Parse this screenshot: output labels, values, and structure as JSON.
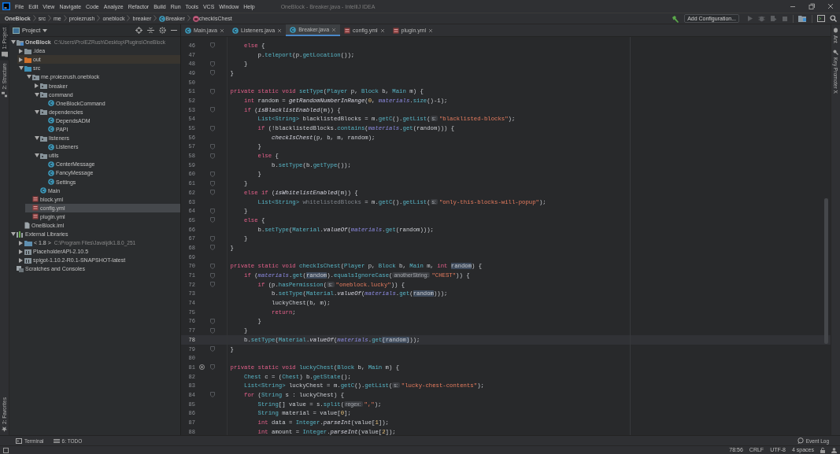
{
  "window": {
    "title": "OneBlock - Breaker.java - IntelliJ IDEA"
  },
  "menu": [
    "File",
    "Edit",
    "View",
    "Navigate",
    "Code",
    "Analyze",
    "Refactor",
    "Build",
    "Run",
    "Tools",
    "VCS",
    "Window",
    "Help"
  ],
  "breadcrumbs": [
    {
      "label": "OneBlock",
      "kind": "project"
    },
    {
      "label": "src",
      "kind": "plain"
    },
    {
      "label": "me",
      "kind": "plain"
    },
    {
      "label": "proiezrush",
      "kind": "plain"
    },
    {
      "label": "oneblock",
      "kind": "plain"
    },
    {
      "label": "breaker",
      "kind": "plain"
    },
    {
      "label": "Breaker",
      "kind": "class"
    },
    {
      "label": "checkIsChest",
      "kind": "method"
    }
  ],
  "toolbar": {
    "run_configuration": "Add Configuration..."
  },
  "left_tool_windows": [
    {
      "label": "1: Project",
      "selected": true
    },
    {
      "label": "2: Structure",
      "selected": false
    }
  ],
  "left_bottom_tool_windows": [
    {
      "label": "2: Favorites"
    }
  ],
  "right_tool_windows": [
    {
      "label": "Ant"
    },
    {
      "label": "Key Promoter X"
    }
  ],
  "project_panel": {
    "title": "Project",
    "tree": [
      {
        "label": "OneBlock",
        "detail": "C:\\Users\\ProIEZRush\\Desktop\\Plugins\\OneBlock",
        "kind": "module",
        "expanded": true,
        "selected": false,
        "hovered": false,
        "children": [
          {
            "label": ".idea",
            "kind": "folder",
            "expanded": false,
            "selected": false,
            "hovered": false
          },
          {
            "label": "out",
            "kind": "excluded",
            "expanded": false,
            "selected": false,
            "hovered": true
          },
          {
            "label": "src",
            "kind": "source",
            "expanded": true,
            "selected": false,
            "hovered": false,
            "children": [
              {
                "label": "me.proiezrush.oneblock",
                "kind": "package",
                "expanded": true,
                "selected": false,
                "hovered": false,
                "children": [
                  {
                    "label": "breaker",
                    "kind": "package",
                    "expanded": false,
                    "selected": false,
                    "hovered": false
                  },
                  {
                    "label": "command",
                    "kind": "package",
                    "expanded": true,
                    "selected": false,
                    "hovered": false,
                    "children": [
                      {
                        "label": "OneBlockCommand",
                        "kind": "class",
                        "selected": false,
                        "hovered": false
                      }
                    ]
                  },
                  {
                    "label": "dependencies",
                    "kind": "package",
                    "expanded": true,
                    "selected": false,
                    "hovered": false,
                    "children": [
                      {
                        "label": "DependsADM",
                        "kind": "class",
                        "selected": false,
                        "hovered": false
                      },
                      {
                        "label": "PAPI",
                        "kind": "class",
                        "selected": false,
                        "hovered": false
                      }
                    ]
                  },
                  {
                    "label": "listeners",
                    "kind": "package",
                    "expanded": true,
                    "selected": false,
                    "hovered": false,
                    "children": [
                      {
                        "label": "Listeners",
                        "kind": "class",
                        "selected": false,
                        "hovered": false
                      }
                    ]
                  },
                  {
                    "label": "utils",
                    "kind": "package",
                    "expanded": true,
                    "selected": false,
                    "hovered": false,
                    "children": [
                      {
                        "label": "CenterMessage",
                        "kind": "class",
                        "selected": false,
                        "hovered": false
                      },
                      {
                        "label": "FancyMessage",
                        "kind": "class",
                        "selected": false,
                        "hovered": false
                      },
                      {
                        "label": "Settings",
                        "kind": "class",
                        "selected": false,
                        "hovered": false
                      }
                    ]
                  },
                  {
                    "label": "Main",
                    "kind": "class",
                    "selected": false,
                    "hovered": false
                  }
                ]
              },
              {
                "label": "block.yml",
                "kind": "yml",
                "selected": false,
                "hovered": false
              },
              {
                "label": "config.yml",
                "kind": "yml",
                "selected": true,
                "hovered": false
              },
              {
                "label": "plugin.yml",
                "kind": "yml",
                "selected": false,
                "hovered": false
              }
            ]
          },
          {
            "label": "OneBlock.iml",
            "kind": "iml",
            "selected": false,
            "hovered": false
          }
        ]
      },
      {
        "label": "External Libraries",
        "kind": "libraries",
        "expanded": true,
        "selected": false,
        "hovered": false,
        "children": [
          {
            "label": "< 1.8 >",
            "detail": "C:\\Program Files\\Java\\jdk1.8.0_251",
            "kind": "jdk",
            "expanded": false,
            "selected": false,
            "hovered": false
          },
          {
            "label": "PlaceholderAPI-2.10.5",
            "kind": "library",
            "expanded": false,
            "selected": false,
            "hovered": false
          },
          {
            "label": "spigot-1.10.2-R0.1-SNAPSHOT-latest",
            "kind": "library",
            "expanded": false,
            "selected": false,
            "hovered": false
          }
        ]
      },
      {
        "label": "Scratches and Consoles",
        "kind": "scratches",
        "selected": false,
        "hovered": false
      }
    ]
  },
  "editor_tabs": [
    {
      "label": "Main.java",
      "kind": "class",
      "selected": false
    },
    {
      "label": "Listeners.java",
      "kind": "class",
      "selected": false
    },
    {
      "label": "Breaker.java",
      "kind": "class",
      "selected": true
    },
    {
      "label": "config.yml",
      "kind": "yml",
      "selected": false
    },
    {
      "label": "plugin.yml",
      "kind": "yml",
      "selected": false
    }
  ],
  "editor": {
    "lines": [
      {
        "number": "46",
        "fold": true,
        "current": false,
        "tokens": [
          {
            "kind": "keyword",
            "text": "        else"
          },
          {
            "kind": "plain",
            "text": " {"
          }
        ]
      },
      {
        "number": "47",
        "fold": false,
        "current": false,
        "tokens": [
          {
            "kind": "plain",
            "text": "            p."
          },
          {
            "kind": "method",
            "text": "teleport"
          },
          {
            "kind": "plain",
            "text": "(p."
          },
          {
            "kind": "method",
            "text": "getLocation"
          },
          {
            "kind": "plain",
            "text": "());"
          }
        ]
      },
      {
        "number": "48",
        "fold": true,
        "current": false,
        "tokens": [
          {
            "kind": "plain",
            "text": "        }"
          }
        ]
      },
      {
        "number": "49",
        "fold": true,
        "current": false,
        "tokens": [
          {
            "kind": "plain",
            "text": "    }"
          }
        ]
      },
      {
        "number": "50",
        "fold": false,
        "current": false
      },
      {
        "number": "51",
        "fold": true,
        "current": false,
        "tokens": [
          {
            "kind": "keyword",
            "text": "    private static void "
          },
          {
            "kind": "method",
            "text": "setType"
          },
          {
            "kind": "plain",
            "text": "("
          },
          {
            "kind": "type",
            "text": "Player"
          },
          {
            "kind": "plain",
            "text": " p, "
          },
          {
            "kind": "type",
            "text": "Block"
          },
          {
            "kind": "plain",
            "text": " b, "
          },
          {
            "kind": "type",
            "text": "Main"
          },
          {
            "kind": "plain",
            "text": " m) {"
          }
        ]
      },
      {
        "number": "52",
        "fold": false,
        "current": false,
        "tokens": [
          {
            "kind": "keyword",
            "text": "        int"
          },
          {
            "kind": "plain",
            "text": " random = "
          },
          {
            "kind": "static",
            "text": "getRandomNumberInRange"
          },
          {
            "kind": "plain",
            "text": "("
          },
          {
            "kind": "number",
            "text": "0"
          },
          {
            "kind": "plain",
            "text": ", "
          },
          {
            "kind": "field",
            "text": "materials"
          },
          {
            "kind": "plain",
            "text": "."
          },
          {
            "kind": "method",
            "text": "size"
          },
          {
            "kind": "plain",
            "text": "()-1);"
          }
        ]
      },
      {
        "number": "53",
        "fold": true,
        "current": false,
        "tokens": [
          {
            "kind": "keyword",
            "text": "        if"
          },
          {
            "kind": "plain",
            "text": " ("
          },
          {
            "kind": "static",
            "text": "isBlacklistEnabled"
          },
          {
            "kind": "plain",
            "text": "(m)) {"
          }
        ]
      },
      {
        "number": "54",
        "fold": false,
        "current": false,
        "tokens": [
          {
            "kind": "type",
            "text": "            List<String>"
          },
          {
            "kind": "plain",
            "text": " blacklistedBlocks = m."
          },
          {
            "kind": "method",
            "text": "getC"
          },
          {
            "kind": "plain",
            "text": "()."
          },
          {
            "kind": "method",
            "text": "getList"
          },
          {
            "kind": "plain",
            "text": "("
          },
          {
            "kind": "hint",
            "text": "s:"
          },
          {
            "kind": "string",
            "text": "\"blacklisted-blocks\""
          },
          {
            "kind": "plain",
            "text": ");"
          }
        ]
      },
      {
        "number": "55",
        "fold": true,
        "current": false,
        "tokens": [
          {
            "kind": "keyword",
            "text": "            if"
          },
          {
            "kind": "plain",
            "text": " (!blacklistedBlocks."
          },
          {
            "kind": "method",
            "text": "contains"
          },
          {
            "kind": "plain",
            "text": "("
          },
          {
            "kind": "field",
            "text": "materials"
          },
          {
            "kind": "plain",
            "text": "."
          },
          {
            "kind": "method",
            "text": "get"
          },
          {
            "kind": "plain",
            "text": "(random))) {"
          }
        ]
      },
      {
        "number": "56",
        "fold": false,
        "current": false,
        "tokens": [
          {
            "kind": "static",
            "text": "                checkIsChest"
          },
          {
            "kind": "plain",
            "text": "(p, b, m, random);"
          }
        ]
      },
      {
        "number": "57",
        "fold": true,
        "current": false,
        "tokens": [
          {
            "kind": "plain",
            "text": "            }"
          }
        ]
      },
      {
        "number": "58",
        "fold": true,
        "current": false,
        "tokens": [
          {
            "kind": "keyword",
            "text": "            else"
          },
          {
            "kind": "plain",
            "text": " {"
          }
        ]
      },
      {
        "number": "59",
        "fold": false,
        "current": false,
        "tokens": [
          {
            "kind": "plain",
            "text": "                b."
          },
          {
            "kind": "method",
            "text": "setType"
          },
          {
            "kind": "plain",
            "text": "(b."
          },
          {
            "kind": "method",
            "text": "getType"
          },
          {
            "kind": "plain",
            "text": "());"
          }
        ]
      },
      {
        "number": "60",
        "fold": true,
        "current": false,
        "tokens": [
          {
            "kind": "plain",
            "text": "            }"
          }
        ]
      },
      {
        "number": "61",
        "fold": true,
        "current": false,
        "tokens": [
          {
            "kind": "plain",
            "text": "        }"
          }
        ]
      },
      {
        "number": "62",
        "fold": true,
        "current": false,
        "tokens": [
          {
            "kind": "keyword",
            "text": "        else if"
          },
          {
            "kind": "plain",
            "text": " ("
          },
          {
            "kind": "static",
            "text": "isWhitelistEnabled"
          },
          {
            "kind": "plain",
            "text": "(m)) {"
          }
        ]
      },
      {
        "number": "63",
        "fold": false,
        "current": false,
        "tokens": [
          {
            "kind": "type",
            "text": "            List<String>"
          },
          {
            "kind": "unused",
            "text": " whitelistedBlocks"
          },
          {
            "kind": "plain",
            "text": " = m."
          },
          {
            "kind": "method",
            "text": "getC"
          },
          {
            "kind": "plain",
            "text": "()."
          },
          {
            "kind": "method",
            "text": "getList"
          },
          {
            "kind": "plain",
            "text": "("
          },
          {
            "kind": "hint",
            "text": "s:"
          },
          {
            "kind": "string",
            "text": "\"only-this-blocks-will-popup\""
          },
          {
            "kind": "plain",
            "text": ");"
          }
        ]
      },
      {
        "number": "64",
        "fold": true,
        "current": false,
        "tokens": [
          {
            "kind": "plain",
            "text": "        }"
          }
        ]
      },
      {
        "number": "65",
        "fold": true,
        "current": false,
        "tokens": [
          {
            "kind": "keyword",
            "text": "        else"
          },
          {
            "kind": "plain",
            "text": " {"
          }
        ]
      },
      {
        "number": "66",
        "fold": false,
        "current": false,
        "tokens": [
          {
            "kind": "plain",
            "text": "            b."
          },
          {
            "kind": "method",
            "text": "setType"
          },
          {
            "kind": "plain",
            "text": "("
          },
          {
            "kind": "type",
            "text": "Material"
          },
          {
            "kind": "plain",
            "text": "."
          },
          {
            "kind": "static",
            "text": "valueOf"
          },
          {
            "kind": "plain",
            "text": "("
          },
          {
            "kind": "field",
            "text": "materials"
          },
          {
            "kind": "plain",
            "text": "."
          },
          {
            "kind": "method",
            "text": "get"
          },
          {
            "kind": "plain",
            "text": "(random)));"
          }
        ]
      },
      {
        "number": "67",
        "fold": true,
        "current": false,
        "tokens": [
          {
            "kind": "plain",
            "text": "        }"
          }
        ]
      },
      {
        "number": "68",
        "fold": true,
        "current": false,
        "tokens": [
          {
            "kind": "plain",
            "text": "    }"
          }
        ]
      },
      {
        "number": "69",
        "fold": false,
        "current": false
      },
      {
        "number": "70",
        "fold": true,
        "current": false,
        "tokens": [
          {
            "kind": "keyword",
            "text": "    private static void "
          },
          {
            "kind": "method",
            "text": "checkIsChest"
          },
          {
            "kind": "plain",
            "text": "("
          },
          {
            "kind": "type",
            "text": "Player"
          },
          {
            "kind": "plain",
            "text": " p, "
          },
          {
            "kind": "type",
            "text": "Block"
          },
          {
            "kind": "plain",
            "text": " b, "
          },
          {
            "kind": "type",
            "text": "Main"
          },
          {
            "kind": "plain",
            "text": " m, "
          },
          {
            "kind": "keyword",
            "text": "int "
          },
          {
            "kind": "usage",
            "text": "random"
          },
          {
            "kind": "plain",
            "text": ") {"
          }
        ]
      },
      {
        "number": "71",
        "fold": true,
        "current": false,
        "tokens": [
          {
            "kind": "keyword",
            "text": "        if"
          },
          {
            "kind": "plain",
            "text": " ("
          },
          {
            "kind": "field",
            "text": "materials"
          },
          {
            "kind": "plain",
            "text": "."
          },
          {
            "kind": "method",
            "text": "get"
          },
          {
            "kind": "plain",
            "text": "("
          },
          {
            "kind": "usage",
            "text": "random"
          },
          {
            "kind": "plain",
            "text": ")."
          },
          {
            "kind": "method",
            "text": "equalsIgnoreCase"
          },
          {
            "kind": "plain",
            "text": "("
          },
          {
            "kind": "hint",
            "text": "anotherString:"
          },
          {
            "kind": "string",
            "text": "\"CHEST\""
          },
          {
            "kind": "plain",
            "text": ")) {"
          }
        ]
      },
      {
        "number": "72",
        "fold": true,
        "current": false,
        "tokens": [
          {
            "kind": "keyword",
            "text": "            if"
          },
          {
            "kind": "plain",
            "text": " (p."
          },
          {
            "kind": "method",
            "text": "hasPermission"
          },
          {
            "kind": "plain",
            "text": "("
          },
          {
            "kind": "hint",
            "text": "s:"
          },
          {
            "kind": "string",
            "text": "\"oneblock.lucky\""
          },
          {
            "kind": "plain",
            "text": ")) {"
          }
        ]
      },
      {
        "number": "73",
        "fold": false,
        "current": false,
        "tokens": [
          {
            "kind": "plain",
            "text": "                b."
          },
          {
            "kind": "method",
            "text": "setType"
          },
          {
            "kind": "plain",
            "text": "("
          },
          {
            "kind": "type",
            "text": "Material"
          },
          {
            "kind": "plain",
            "text": "."
          },
          {
            "kind": "static",
            "text": "valueOf"
          },
          {
            "kind": "plain",
            "text": "("
          },
          {
            "kind": "field",
            "text": "materials"
          },
          {
            "kind": "plain",
            "text": "."
          },
          {
            "kind": "method",
            "text": "get"
          },
          {
            "kind": "plain",
            "text": "("
          },
          {
            "kind": "usage",
            "text": "random"
          },
          {
            "kind": "plain",
            "text": ")));"
          }
        ]
      },
      {
        "number": "74",
        "fold": false,
        "current": false,
        "tokens": [
          {
            "kind": "plain",
            "text": "                luckyChest(b, m);"
          }
        ]
      },
      {
        "number": "75",
        "fold": false,
        "current": false,
        "tokens": [
          {
            "kind": "keyword",
            "text": "                return"
          },
          {
            "kind": "plain",
            "text": ";"
          }
        ]
      },
      {
        "number": "76",
        "fold": true,
        "current": false,
        "tokens": [
          {
            "kind": "plain",
            "text": "            }"
          }
        ]
      },
      {
        "number": "77",
        "fold": true,
        "current": false,
        "tokens": [
          {
            "kind": "plain",
            "text": "        }"
          }
        ]
      },
      {
        "number": "78",
        "fold": false,
        "current": true,
        "tokens": [
          {
            "kind": "plain",
            "text": "        b."
          },
          {
            "kind": "method",
            "text": "setType"
          },
          {
            "kind": "plain",
            "text": "("
          },
          {
            "kind": "type",
            "text": "Material"
          },
          {
            "kind": "plain",
            "text": "."
          },
          {
            "kind": "static",
            "text": "valueOf"
          },
          {
            "kind": "plain",
            "text": "("
          },
          {
            "kind": "field",
            "text": "materials"
          },
          {
            "kind": "plain",
            "text": "."
          },
          {
            "kind": "method",
            "text": "get"
          },
          {
            "kind": "usage",
            "text": "(random)"
          },
          {
            "kind": "plain",
            "text": "));"
          }
        ]
      },
      {
        "number": "79",
        "fold": true,
        "current": false,
        "tokens": [
          {
            "kind": "plain",
            "text": "    }"
          }
        ]
      },
      {
        "number": "80",
        "fold": false,
        "current": false
      },
      {
        "number": "81",
        "fold": true,
        "current": false,
        "recursive": true,
        "tokens": [
          {
            "kind": "keyword",
            "text": "    private static void "
          },
          {
            "kind": "method",
            "text": "luckyChest"
          },
          {
            "kind": "plain",
            "text": "("
          },
          {
            "kind": "type",
            "text": "Block"
          },
          {
            "kind": "plain",
            "text": " b, "
          },
          {
            "kind": "type",
            "text": "Main"
          },
          {
            "kind": "plain",
            "text": " m) {"
          }
        ]
      },
      {
        "number": "82",
        "fold": false,
        "current": false,
        "tokens": [
          {
            "kind": "type",
            "text": "        Chest"
          },
          {
            "kind": "plain",
            "text": " c = ("
          },
          {
            "kind": "type",
            "text": "Chest"
          },
          {
            "kind": "plain",
            "text": ") b."
          },
          {
            "kind": "method",
            "text": "getState"
          },
          {
            "kind": "plain",
            "text": "();"
          }
        ]
      },
      {
        "number": "83",
        "fold": false,
        "current": false,
        "tokens": [
          {
            "kind": "type",
            "text": "        List<String>"
          },
          {
            "kind": "plain",
            "text": " luckyChest = m."
          },
          {
            "kind": "method",
            "text": "getC"
          },
          {
            "kind": "plain",
            "text": "()."
          },
          {
            "kind": "method",
            "text": "getList"
          },
          {
            "kind": "plain",
            "text": "("
          },
          {
            "kind": "hint",
            "text": "s:"
          },
          {
            "kind": "string",
            "text": "\"lucky-chest-contents\""
          },
          {
            "kind": "plain",
            "text": ");"
          }
        ]
      },
      {
        "number": "84",
        "fold": true,
        "current": false,
        "tokens": [
          {
            "kind": "keyword",
            "text": "        for"
          },
          {
            "kind": "plain",
            "text": " ("
          },
          {
            "kind": "type",
            "text": "String"
          },
          {
            "kind": "plain",
            "text": " s : luckyChest) {"
          }
        ]
      },
      {
        "number": "85",
        "fold": false,
        "current": false,
        "tokens": [
          {
            "kind": "type",
            "text": "            String"
          },
          {
            "kind": "plain",
            "text": "[] value = s."
          },
          {
            "kind": "method",
            "text": "split"
          },
          {
            "kind": "plain",
            "text": "("
          },
          {
            "kind": "hint",
            "text": "regex:"
          },
          {
            "kind": "string",
            "text": "\",\""
          },
          {
            "kind": "plain",
            "text": ");"
          }
        ]
      },
      {
        "number": "86",
        "fold": false,
        "current": false,
        "tokens": [
          {
            "kind": "type",
            "text": "            String"
          },
          {
            "kind": "plain",
            "text": " material = value["
          },
          {
            "kind": "number",
            "text": "0"
          },
          {
            "kind": "plain",
            "text": "];"
          }
        ]
      },
      {
        "number": "87",
        "fold": false,
        "current": false,
        "tokens": [
          {
            "kind": "keyword",
            "text": "            int"
          },
          {
            "kind": "plain",
            "text": " data = "
          },
          {
            "kind": "type",
            "text": "Integer"
          },
          {
            "kind": "plain",
            "text": "."
          },
          {
            "kind": "static",
            "text": "parseInt"
          },
          {
            "kind": "plain",
            "text": "(value["
          },
          {
            "kind": "number",
            "text": "1"
          },
          {
            "kind": "plain",
            "text": "]);"
          }
        ]
      },
      {
        "number": "88",
        "fold": false,
        "current": false,
        "tokens": [
          {
            "kind": "keyword",
            "text": "            int"
          },
          {
            "kind": "plain",
            "text": " amount = "
          },
          {
            "kind": "type",
            "text": "Integer"
          },
          {
            "kind": "plain",
            "text": "."
          },
          {
            "kind": "static",
            "text": "parseInt"
          },
          {
            "kind": "plain",
            "text": "(value["
          },
          {
            "kind": "number",
            "text": "2"
          },
          {
            "kind": "plain",
            "text": "]);"
          }
        ]
      }
    ]
  },
  "bottom_tool_windows": [
    {
      "label": "Terminal",
      "kind": "terminal"
    },
    {
      "label": "6: TODO",
      "kind": "todo"
    }
  ],
  "event_log": "Event Log",
  "status_bar": {
    "position": "78:56",
    "line_separator": "CRLF",
    "encoding": "UTF-8",
    "indent": "4 spaces"
  }
}
